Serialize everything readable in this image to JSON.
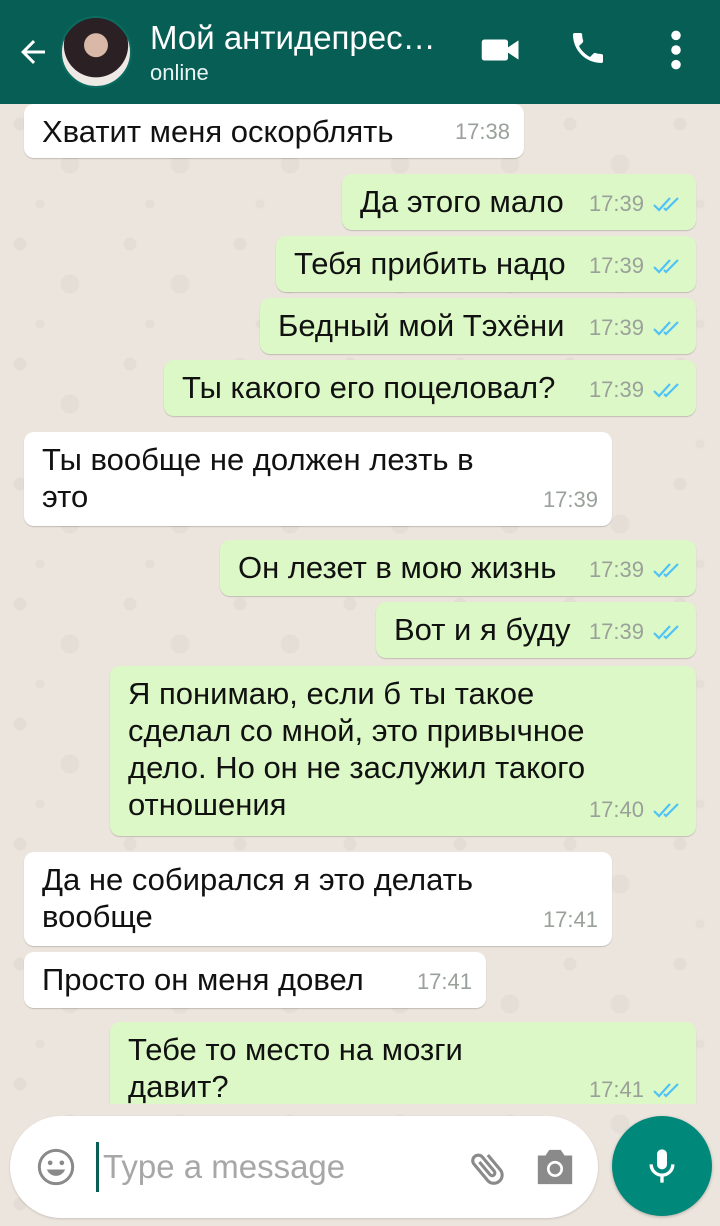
{
  "header": {
    "title": "Мой антидепрес…",
    "status": "online"
  },
  "colors": {
    "header": "#075e54",
    "incoming": "#ffffff",
    "outgoing": "#dcf8c6",
    "read_ticks": "#4fc3f7",
    "mic_button": "#00897b"
  },
  "messages": [
    {
      "dir": "in",
      "text": "Хватит меня оскорблять",
      "time": "17:38"
    },
    {
      "dir": "out",
      "text": "Да этого мало",
      "time": "17:39",
      "read": true
    },
    {
      "dir": "out",
      "text": "Тебя прибить надо",
      "time": "17:39",
      "read": true
    },
    {
      "dir": "out",
      "text": "Бедный мой Тэхёни",
      "time": "17:39",
      "read": true
    },
    {
      "dir": "out",
      "text": "Ты какого его поцеловал?",
      "time": "17:39",
      "read": true
    },
    {
      "dir": "in",
      "text": "Ты вообще не должен лезть в это",
      "time": "17:39"
    },
    {
      "dir": "out",
      "text": "Он лезет в мою жизнь",
      "time": "17:39",
      "read": true
    },
    {
      "dir": "out",
      "text": "Вот и я буду",
      "time": "17:39",
      "read": true
    },
    {
      "dir": "out",
      "text": "Я понимаю, если б ты такое сделал со мной, это привычное дело. Но он не заслужил такого отношения",
      "time": "17:40",
      "read": true
    },
    {
      "dir": "in",
      "text": "Да не собирался я это делать вообще",
      "time": "17:41"
    },
    {
      "dir": "in",
      "text": "Просто он меня довел",
      "time": "17:41"
    },
    {
      "dir": "out",
      "text": "Тебе то место на мозги давит?",
      "time": "17:41",
      "read": true
    }
  ],
  "composer": {
    "placeholder": "Type a message",
    "icons": [
      "emoji-icon",
      "attach-icon",
      "camera-icon",
      "mic-icon"
    ]
  }
}
